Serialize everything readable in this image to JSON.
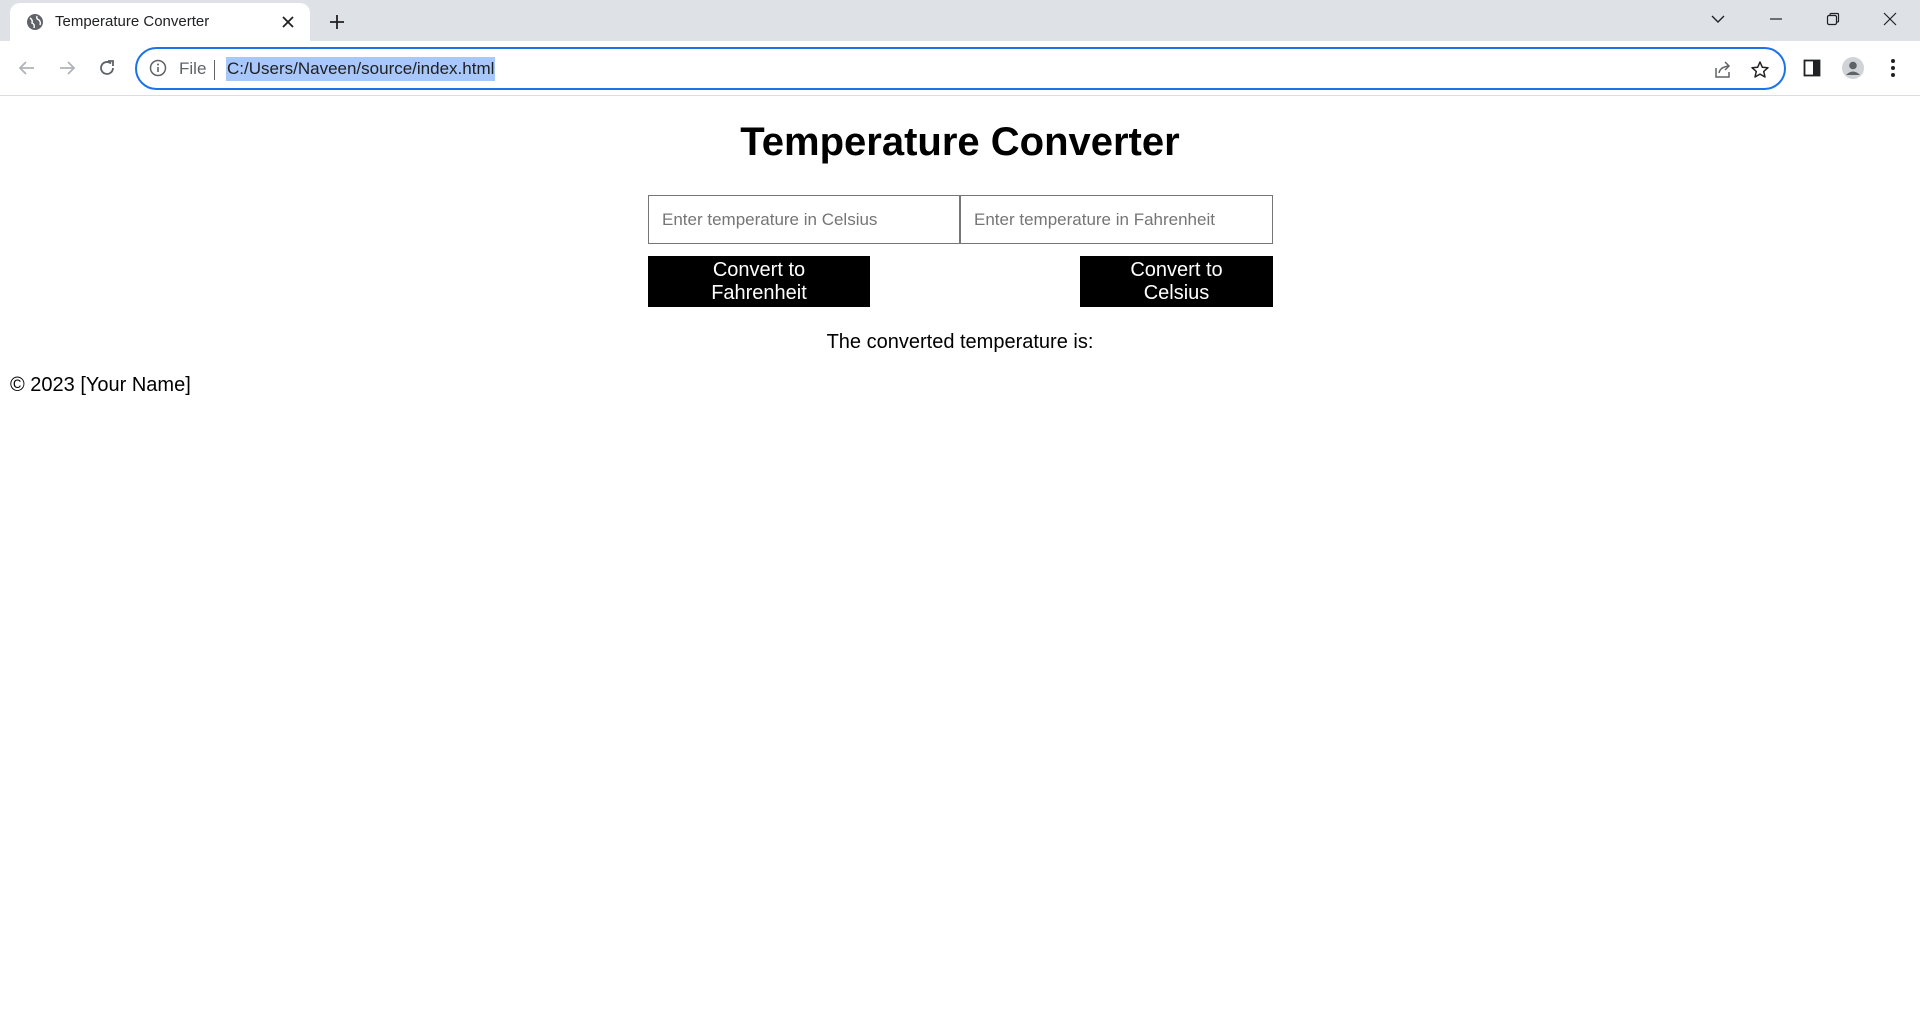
{
  "browser": {
    "tab": {
      "title": "Temperature Converter"
    },
    "address": {
      "scheme_label": "File",
      "url": "C:/Users/Naveen/source/index.html"
    }
  },
  "page": {
    "title": "Temperature Converter",
    "celsius_input": {
      "placeholder": "Enter temperature in Celsius",
      "value": ""
    },
    "fahrenheit_input": {
      "placeholder": "Enter temperature in Fahrenheit",
      "value": ""
    },
    "to_fahrenheit_button": "Convert to Fahrenheit",
    "to_celsius_button": "Convert to Celsius",
    "result_label": "The converted temperature is:",
    "footer": "© 2023 [Your Name]"
  },
  "icons": {
    "tab": [
      "globe-icon",
      "close-icon",
      "plus-icon"
    ],
    "window": [
      "chevron-down-icon",
      "minimize-icon",
      "restore-icon",
      "close-icon"
    ],
    "toolbar": [
      "back-arrow-icon",
      "forward-arrow-icon",
      "reload-icon",
      "info-icon",
      "share-icon",
      "star-icon",
      "side-panel-icon",
      "profile-icon",
      "more-vert-icon"
    ]
  },
  "colors": {
    "chrome_bg": "#dee1e6",
    "focus_ring": "#1a73e8",
    "url_selection": "#a8c7fa",
    "button_bg": "#000000",
    "button_text": "#ffffff"
  }
}
